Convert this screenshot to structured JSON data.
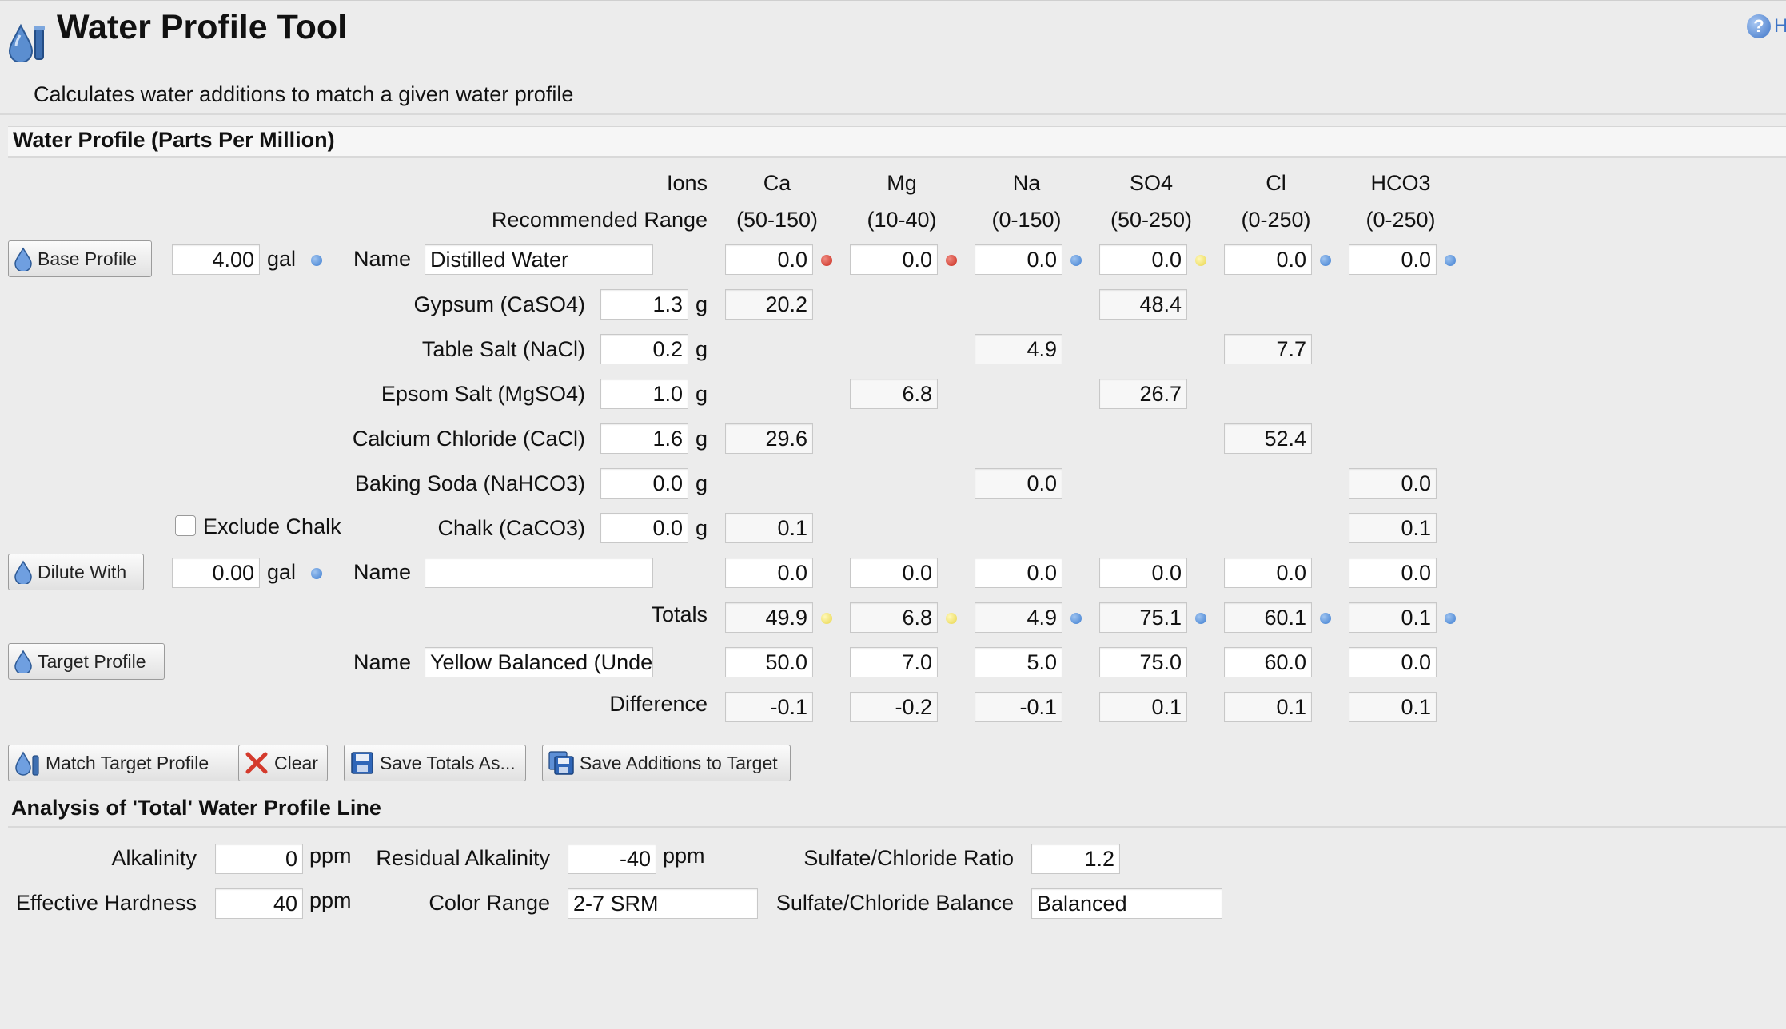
{
  "header": {
    "title": "Water Profile Tool",
    "subtitle": "Calculates water additions to match a given water profile",
    "help_label": "H"
  },
  "profile_section": {
    "title": "Water Profile (Parts Per Million)",
    "ions_label": "Ions",
    "range_label": "Recommended Range",
    "ions": [
      "Ca",
      "Mg",
      "Na",
      "SO4",
      "Cl",
      "HCO3"
    ],
    "ranges": [
      "(50-150)",
      "(10-40)",
      "(0-150)",
      "(50-250)",
      "(0-250)",
      "(0-250)"
    ]
  },
  "base": {
    "button_label": "Base Profile",
    "volume": "4.00",
    "unit": "gal",
    "name_label": "Name",
    "name": "Distilled Water",
    "values": [
      "0.0",
      "0.0",
      "0.0",
      "0.0",
      "0.0",
      "0.0"
    ],
    "status": [
      "red",
      "red",
      "blue",
      "yellow",
      "blue",
      "blue"
    ]
  },
  "additions": [
    {
      "label": "Gypsum (CaSO4)",
      "amount": "1.3",
      "unit": "g",
      "ppm": [
        "20.2",
        null,
        null,
        "48.4",
        null,
        null
      ]
    },
    {
      "label": "Table Salt (NaCl)",
      "amount": "0.2",
      "unit": "g",
      "ppm": [
        null,
        null,
        "4.9",
        null,
        "7.7",
        null
      ]
    },
    {
      "label": "Epsom Salt (MgSO4)",
      "amount": "1.0",
      "unit": "g",
      "ppm": [
        null,
        "6.8",
        null,
        "26.7",
        null,
        null
      ]
    },
    {
      "label": "Calcium Chloride (CaCl)",
      "amount": "1.6",
      "unit": "g",
      "ppm": [
        "29.6",
        null,
        null,
        null,
        "52.4",
        null
      ]
    },
    {
      "label": "Baking Soda (NaHCO3)",
      "amount": "0.0",
      "unit": "g",
      "ppm": [
        null,
        null,
        "0.0",
        null,
        null,
        "0.0"
      ]
    },
    {
      "label": "Chalk (CaCO3)",
      "amount": "0.0",
      "unit": "g",
      "ppm": [
        "0.1",
        null,
        null,
        null,
        null,
        "0.1"
      ]
    }
  ],
  "exclude_chalk": {
    "label": "Exclude Chalk",
    "checked": false
  },
  "dilute": {
    "button_label": "Dilute With",
    "volume": "0.00",
    "unit": "gal",
    "name_label": "Name",
    "name": "",
    "values": [
      "0.0",
      "0.0",
      "0.0",
      "0.0",
      "0.0",
      "0.0"
    ]
  },
  "totals": {
    "label": "Totals",
    "values": [
      "49.9",
      "6.8",
      "4.9",
      "75.1",
      "60.1",
      "0.1"
    ],
    "status": [
      "yellow",
      "yellow",
      "blue",
      "blue",
      "blue",
      "blue"
    ]
  },
  "target": {
    "button_label": "Target Profile",
    "name_label": "Name",
    "name": "Yellow Balanced (Unde",
    "values": [
      "50.0",
      "7.0",
      "5.0",
      "75.0",
      "60.0",
      "0.0"
    ]
  },
  "difference": {
    "label": "Difference",
    "values": [
      "-0.1",
      "-0.2",
      "-0.1",
      "0.1",
      "0.1",
      "0.1"
    ]
  },
  "actions": {
    "match_label": "Match Target Profile",
    "clear_label": "Clear",
    "save_totals_label": "Save Totals As...",
    "save_additions_label": "Save Additions to Target"
  },
  "analysis": {
    "title": "Analysis of 'Total' Water Profile Line",
    "alkalinity_label": "Alkalinity",
    "alkalinity": "0",
    "alkalinity_unit": "ppm",
    "residual_label": "Residual Alkalinity",
    "residual": "-40",
    "residual_unit": "ppm",
    "ratio_label": "Sulfate/Chloride Ratio",
    "ratio": "1.2",
    "hardness_label": "Effective Hardness",
    "hardness": "40",
    "hardness_unit": "ppm",
    "color_label": "Color Range",
    "color": "2-7 SRM",
    "balance_label": "Sulfate/Chloride Balance",
    "balance": "Balanced"
  },
  "colors": {
    "status_red": "#c92a1d",
    "status_yellow": "#e8d54a",
    "status_blue": "#3d7dd0"
  }
}
